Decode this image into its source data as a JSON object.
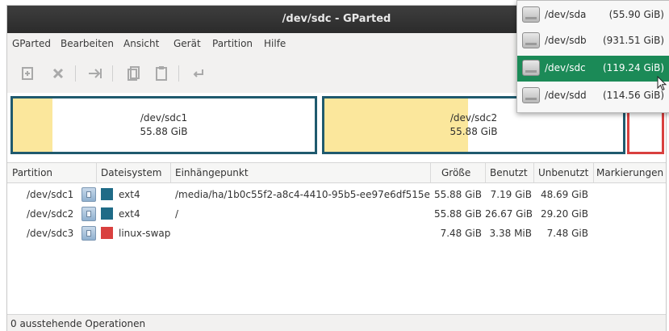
{
  "window": {
    "title": "/dev/sdc - GParted"
  },
  "menubar": {
    "items": [
      "GParted",
      "Bearbeiten",
      "Ansicht",
      "Gerät",
      "Partition",
      "Hilfe"
    ]
  },
  "toolbar": {
    "buttons": [
      "new-partition-icon",
      "delete-icon",
      "resize-move-icon",
      "copy-icon",
      "paste-icon",
      "undo-icon"
    ]
  },
  "diskgraph": {
    "partitions": [
      {
        "name": "/dev/sdc1",
        "size": "55.88 GiB",
        "used_fraction": 0.13,
        "border": "#1f5a6e"
      },
      {
        "name": "/dev/sdc2",
        "size": "55.88 GiB",
        "used_fraction": 0.48,
        "border": "#1f5a6e"
      },
      {
        "name": "",
        "size": "",
        "border": "#d9403f"
      }
    ]
  },
  "table": {
    "headers": {
      "partition": "Partition",
      "filesystem": "Dateisystem",
      "mountpoint": "Einhängepunkt",
      "size": "Größe",
      "used": "Benutzt",
      "unused": "Unbenutzt",
      "flags": "Markierungen"
    },
    "rows": [
      {
        "partition": "/dev/sdc1",
        "filesystem": "ext4",
        "fs_color": "#1f6b87",
        "mountpoint": "/media/ha/1b0c55f2-a8c4-4410-95b5-ee97e6df515e",
        "size": "55.88 GiB",
        "used": "7.19 GiB",
        "unused": "48.69 GiB",
        "flags": ""
      },
      {
        "partition": "/dev/sdc2",
        "filesystem": "ext4",
        "fs_color": "#1f6b87",
        "mountpoint": "/",
        "size": "55.88 GiB",
        "used": "26.67 GiB",
        "unused": "29.20 GiB",
        "flags": ""
      },
      {
        "partition": "/dev/sdc3",
        "filesystem": "linux-swap",
        "fs_color": "#d9403f",
        "mountpoint": "",
        "size": "7.48 GiB",
        "used": "3.38 MiB",
        "unused": "7.48 GiB",
        "flags": ""
      }
    ]
  },
  "statusbar": {
    "text": "0 ausstehende Operationen"
  },
  "device_popup": {
    "selected_index": 2,
    "selected_color": "#1b8a57",
    "devices": [
      {
        "name": "/dev/sda",
        "size": "(55.90 GiB)"
      },
      {
        "name": "/dev/sdb",
        "size": "(931.51 GiB)"
      },
      {
        "name": "/dev/sdc",
        "size": "(119.24 GiB)"
      },
      {
        "name": "/dev/sdd",
        "size": "(114.56 GiB)"
      }
    ]
  }
}
